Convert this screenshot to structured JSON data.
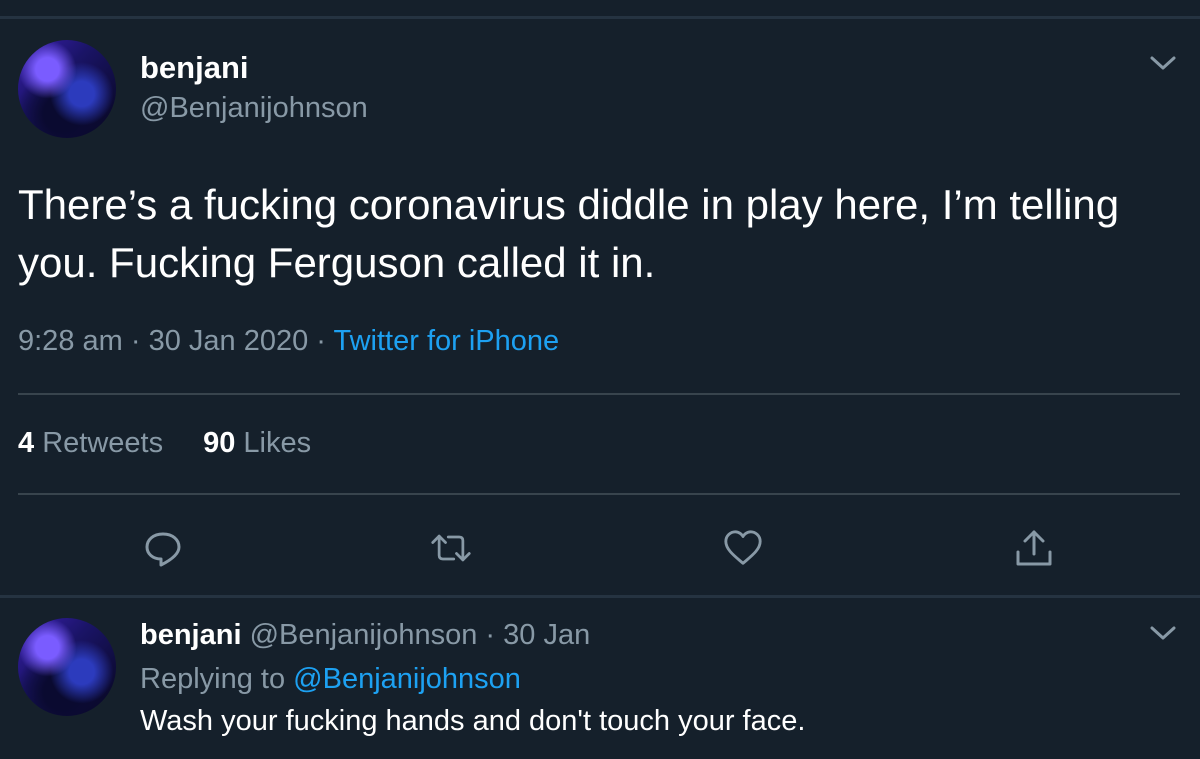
{
  "tweet": {
    "display_name": "benjani",
    "handle": "@Benjanijohnson",
    "text": "There’s a fucking coronavirus diddle in play here, I’m telling you. Fucking Ferguson called it in.",
    "time": "9:28 am",
    "sep1": " · ",
    "date": "30 Jan 2020",
    "sep2": " · ",
    "source": "Twitter for iPhone",
    "retweets_count": "4",
    "retweets_label": "Retweets",
    "likes_count": "90",
    "likes_label": "Likes"
  },
  "reply": {
    "display_name": "benjani",
    "handle": "@Benjanijohnson",
    "sep": " · ",
    "date": "30 Jan",
    "replying_prefix": "Replying to ",
    "replying_to": "@Benjanijohnson",
    "text": "Wash your fucking hands and don't touch your face."
  },
  "icons": [
    "chevron-down-icon",
    "reply-icon",
    "retweet-icon",
    "like-icon",
    "share-icon"
  ],
  "colors": {
    "background": "#15202b",
    "divider": "#38444d",
    "secondary_text": "#8899a6",
    "accent": "#1da1f2"
  }
}
